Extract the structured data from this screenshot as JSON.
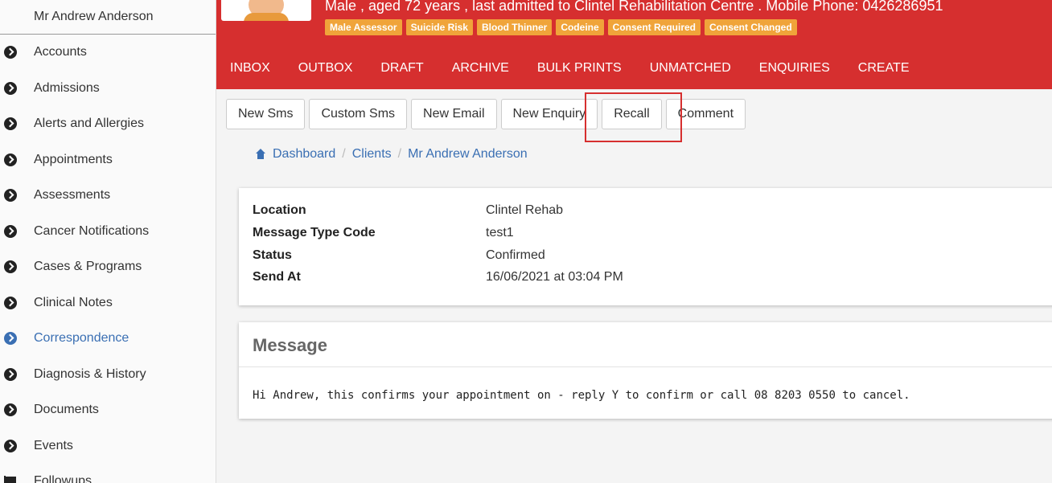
{
  "sidebar": {
    "patient_name": "Mr Andrew Anderson",
    "items": [
      {
        "label": "Accounts",
        "icon": "chevron-circle-right-icon"
      },
      {
        "label": "Admissions",
        "icon": "chevron-circle-right-icon"
      },
      {
        "label": "Alerts and Allergies",
        "icon": "chevron-circle-right-icon"
      },
      {
        "label": "Appointments",
        "icon": "chevron-circle-right-icon"
      },
      {
        "label": "Assessments",
        "icon": "chevron-circle-right-icon"
      },
      {
        "label": "Cancer Notifications",
        "icon": "chevron-circle-right-icon"
      },
      {
        "label": "Cases & Programs",
        "icon": "chevron-circle-right-icon"
      },
      {
        "label": "Clinical Notes",
        "icon": "chevron-circle-right-icon"
      },
      {
        "label": "Correspondence",
        "icon": "chevron-circle-right-icon",
        "active": true
      },
      {
        "label": "Diagnosis & History",
        "icon": "chevron-circle-right-icon"
      },
      {
        "label": "Documents",
        "icon": "chevron-circle-right-icon"
      },
      {
        "label": "Events",
        "icon": "chevron-circle-right-icon"
      },
      {
        "label": "Followups",
        "icon": "flag-icon"
      }
    ]
  },
  "header": {
    "demographics": "Male , aged 72 years , last admitted to Clintel Rehabilitation Centre . Mobile Phone: 0426286951",
    "badges": [
      "Male Assessor",
      "Suicide Risk",
      "Blood Thinner",
      "Codeine",
      "Consent Required",
      "Consent Changed"
    ],
    "nav": [
      "INBOX",
      "OUTBOX",
      "DRAFT",
      "ARCHIVE",
      "BULK PRINTS",
      "UNMATCHED",
      "ENQUIRIES",
      "CREATE"
    ]
  },
  "toolbar": {
    "buttons": [
      "New Sms",
      "Custom Sms",
      "New Email",
      "New Enquiry",
      "Recall",
      "Comment"
    ]
  },
  "breadcrumb": [
    "Dashboard",
    "Clients",
    "Mr Andrew Anderson"
  ],
  "details": [
    {
      "label": "Location",
      "value": "Clintel Rehab"
    },
    {
      "label": "Message Type Code",
      "value": "test1"
    },
    {
      "label": "Status",
      "value": "Confirmed"
    },
    {
      "label": "Send At",
      "value": "16/06/2021 at 03:04 PM"
    }
  ],
  "message": {
    "title": "Message",
    "body": "Hi Andrew, this confirms your appointment on - reply Y to confirm or call 08 8203 0550 to cancel."
  },
  "colors": {
    "header_red": "#d62f2f",
    "badge_orange": "#f0a43a",
    "link_blue": "#3a6fb3"
  }
}
